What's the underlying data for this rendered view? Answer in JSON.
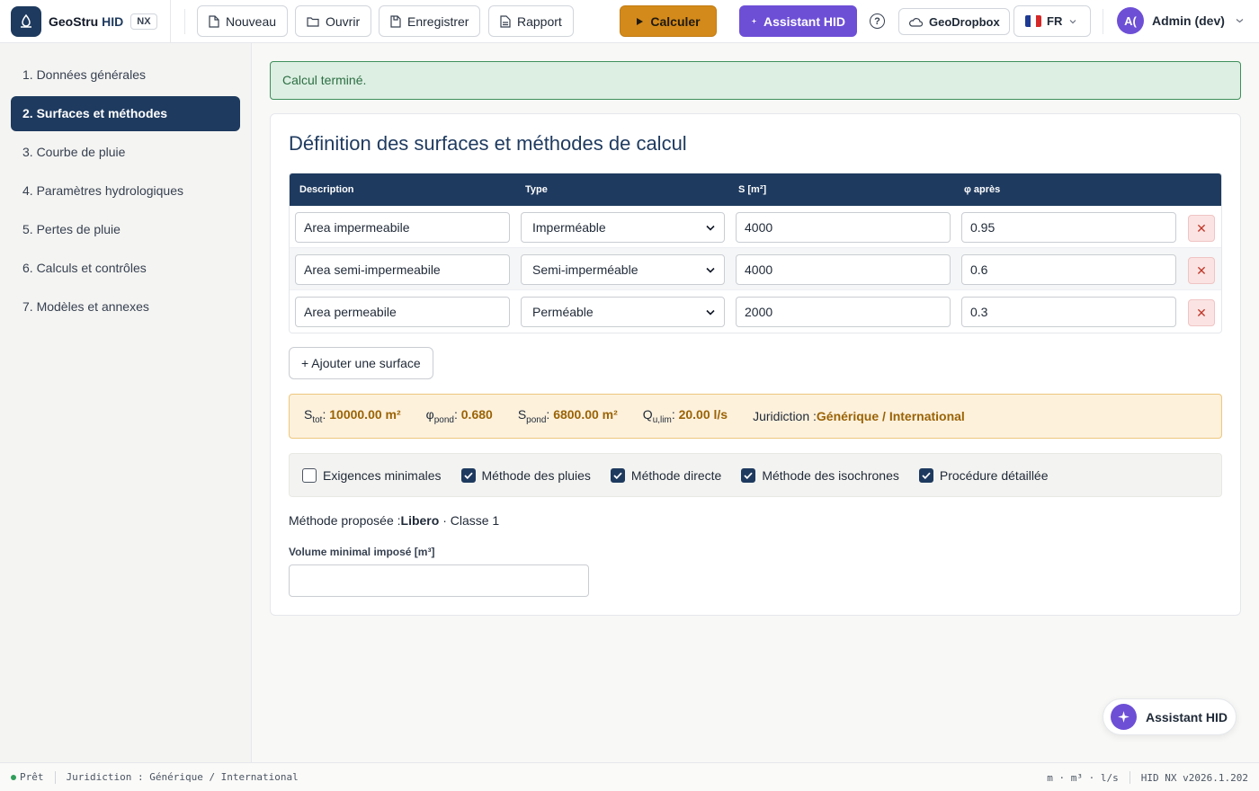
{
  "app": {
    "name": "GeoStru",
    "name_accent": "HID",
    "badge": "NX"
  },
  "toolbar": {
    "new_label": "Nouveau",
    "open_label": "Ouvrir",
    "save_label": "Enregistrer",
    "report_label": "Rapport",
    "calc_label": "Calculer",
    "assistant_label": "Assistant HID",
    "help_label": "?",
    "dropbox_label": "GeoDropbox",
    "lang_label": "FR",
    "user_initials": "A(",
    "user_name": "Admin (dev)"
  },
  "sidebar": {
    "items": [
      {
        "label": "1. Données générales"
      },
      {
        "label": "2. Surfaces et méthodes",
        "active": true
      },
      {
        "label": "3. Courbe de pluie"
      },
      {
        "label": "4. Paramètres hydrologiques"
      },
      {
        "label": "5. Pertes de pluie"
      },
      {
        "label": "6. Calculs et contrôles"
      },
      {
        "label": "7. Modèles et annexes"
      }
    ]
  },
  "alert": {
    "text": "Calcul terminé."
  },
  "card": {
    "title": "Définition des surfaces et méthodes de calcul",
    "table": {
      "headers": [
        "Description",
        "Type",
        "S [m²]",
        "φ après"
      ],
      "rows": [
        {
          "description": "Area impermeabile",
          "type": "Imperméable",
          "area": "4000",
          "phi": "0.95"
        },
        {
          "description": "Area semi-impermeabile",
          "type": "Semi-imperméable",
          "area": "4000",
          "phi": "0.6"
        },
        {
          "description": "Area permeabile",
          "type": "Perméable",
          "area": "2000",
          "phi": "0.3"
        }
      ],
      "delete_glyph": "✕"
    },
    "add_label": "+ Ajouter une surface",
    "summary": {
      "stot_label": "S",
      "stot_sub": "tot",
      "stot_value": "10000.00 m²",
      "phi_label": "φ",
      "phi_sub": "pond",
      "phi_value": "0.680",
      "spond_label": "S",
      "spond_sub": "pond",
      "spond_value": "6800.00 m²",
      "q_label": "Q",
      "q_sub": "u,lim",
      "q_value": "20.00 l/s",
      "jur_label": "Juridiction :",
      "jur_value": "Générique / International"
    },
    "methods": [
      {
        "label": "Exigences minimales",
        "checked": false
      },
      {
        "label": "Méthode des pluies",
        "checked": true
      },
      {
        "label": "Méthode directe",
        "checked": true
      },
      {
        "label": "Méthode des isochrones",
        "checked": true
      },
      {
        "label": "Procédure détaillée",
        "checked": true
      }
    ],
    "proposed_prefix": "Méthode proposée :",
    "proposed_value": "Libero",
    "proposed_suffix": " · Classe 1",
    "volume_label": "Volume minimal imposé [m³]",
    "volume_value": ""
  },
  "fab": {
    "label": "Assistant HID"
  },
  "status": {
    "state": "Prêt",
    "jurisdiction": "Juridiction : Générique / International",
    "units": "m · m³ · l/s",
    "version": "HID NX v2026.1.202"
  },
  "colors": {
    "primary": "#1e3a5f",
    "accent": "#d48a1a",
    "assistant": "#6d4fd6",
    "success": "#2c6e43"
  }
}
